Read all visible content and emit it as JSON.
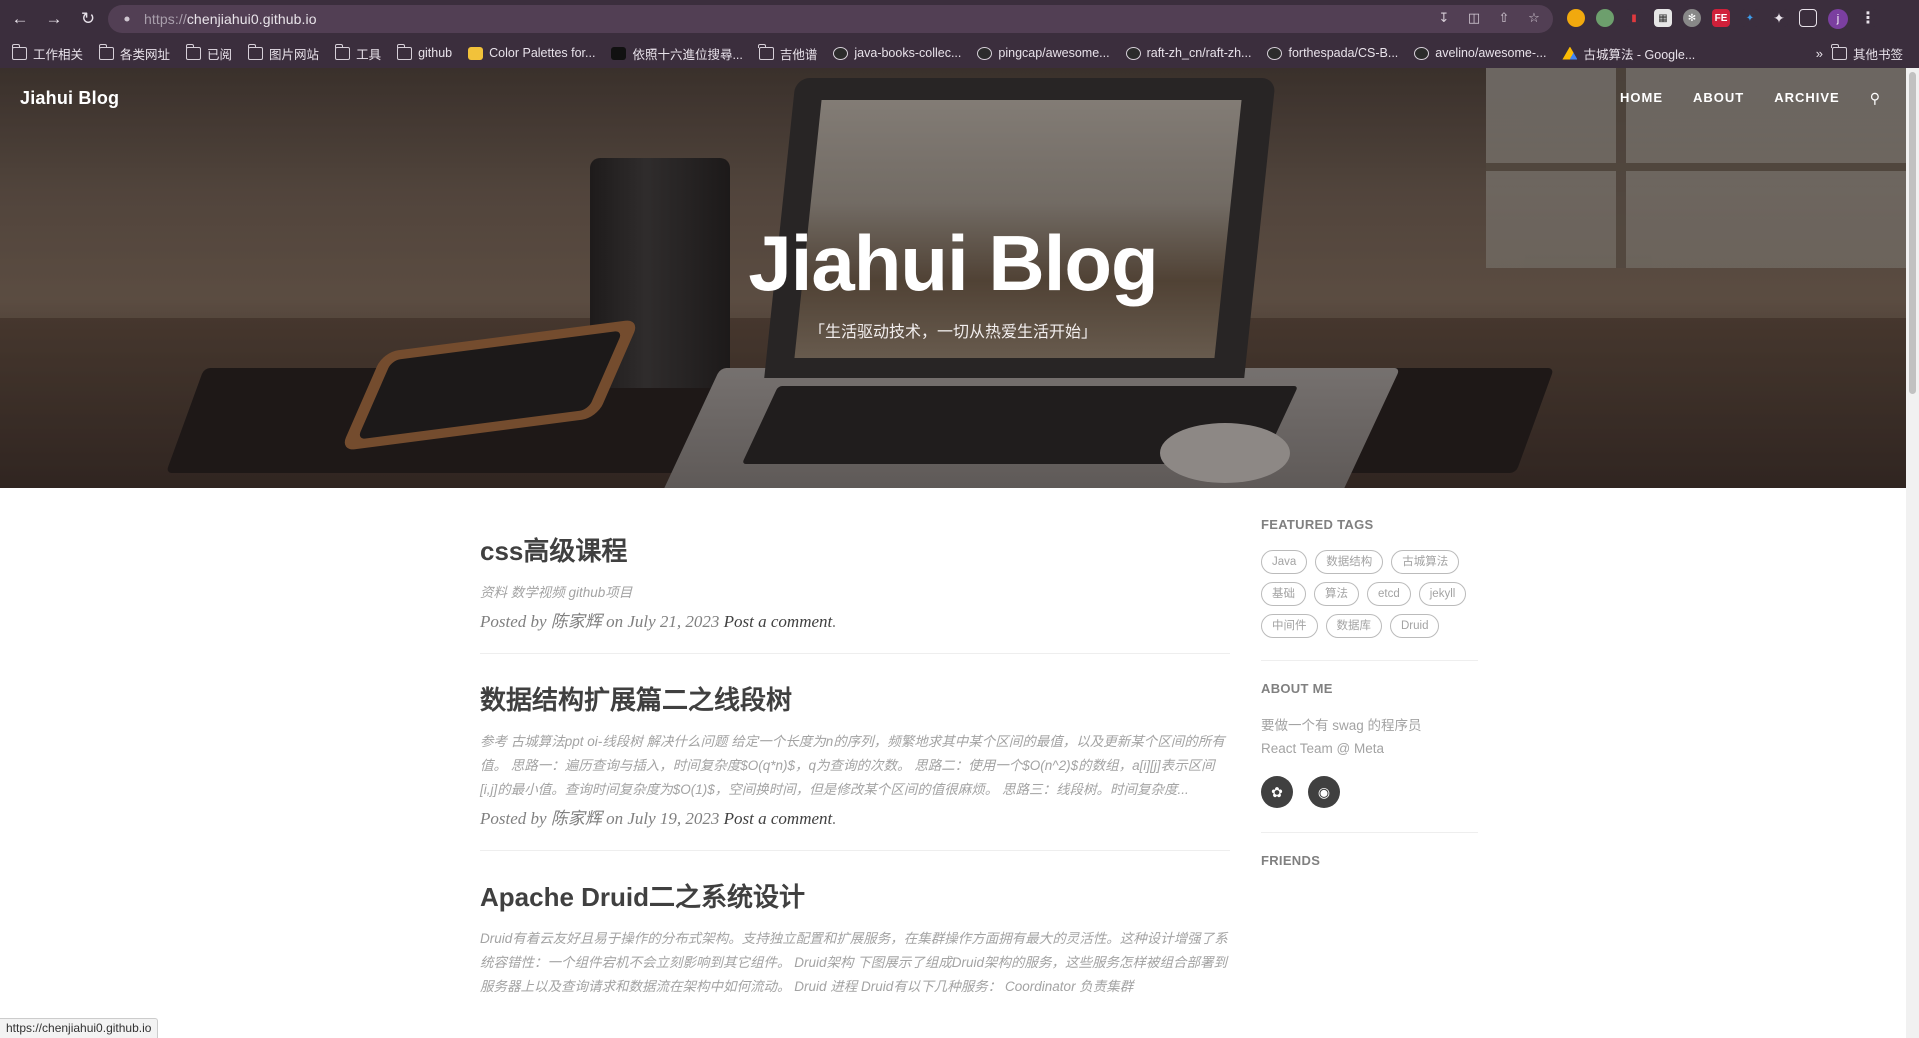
{
  "browser": {
    "url_protocol": "https://",
    "url_host": "chenjiahui0.github.io",
    "bookmarks": [
      {
        "label": "工作相关",
        "type": "folder"
      },
      {
        "label": "各类网址",
        "type": "folder"
      },
      {
        "label": "已阅",
        "type": "folder"
      },
      {
        "label": "图片网站",
        "type": "folder"
      },
      {
        "label": "工具",
        "type": "folder"
      },
      {
        "label": "github",
        "type": "folder"
      },
      {
        "label": "Color Palettes for...",
        "type": "link"
      },
      {
        "label": "依照十六進位搜尋...",
        "type": "link"
      },
      {
        "label": "吉他谱",
        "type": "folder"
      },
      {
        "label": "java-books-collec...",
        "type": "github"
      },
      {
        "label": "pingcap/awesome...",
        "type": "github"
      },
      {
        "label": "raft-zh_cn/raft-zh...",
        "type": "github"
      },
      {
        "label": "forthespada/CS-B...",
        "type": "github"
      },
      {
        "label": "avelino/awesome-...",
        "type": "github"
      },
      {
        "label": "古城算法 - Google...",
        "type": "drive"
      }
    ],
    "bookmarks_more": "»",
    "other_bookmarks": "其他书签",
    "profile_initial": "j",
    "status_url": "https://chenjiahui0.github.io"
  },
  "site": {
    "brand": "Jiahui Blog",
    "nav": [
      "HOME",
      "ABOUT",
      "ARCHIVE"
    ],
    "hero_title": "Jiahui Blog",
    "hero_subtitle": "「生活驱动技术，一切从热爱生活开始」"
  },
  "posts": [
    {
      "title": "css高级课程",
      "excerpt": "资料 数学视频 github项目",
      "posted_by": "Posted by",
      "author": "陈家辉",
      "on": "on",
      "date": "July 21, 2023",
      "comment": "Post a comment"
    },
    {
      "title": "数据结构扩展篇二之线段树",
      "excerpt": "参考 古城算法ppt oi-线段树 解决什么问题 给定一个长度为n的序列，频繁地求其中某个区间的最值，以及更新某个区间的所有值。 思路一：遍历查询与插入，时间复杂度$O(q*n)$，q为查询的次数。 思路二：使用一个$O(n^2)$的数组，a[i][j]表示区间[i,j]的最小值。查询时间复杂度为$O(1)$，空间换时间，但是修改某个区间的值很麻烦。 思路三：线段树。时间复杂度...",
      "posted_by": "Posted by",
      "author": "陈家辉",
      "on": "on",
      "date": "July 19, 2023",
      "comment": "Post a comment"
    },
    {
      "title": "Apache Druid二之系统设计",
      "excerpt": "Druid有着云友好且易于操作的分布式架构。支持独立配置和扩展服务，在集群操作方面拥有最大的灵活性。这种设计增强了系统容错性：一个组件宕机不会立刻影响到其它组件。 Druid架构 下图展示了组成Druid架构的服务，这些服务怎样被组合部署到服务器上以及查询请求和数据流在架构中如何流动。 Druid 进程 Druid有以下几种服务： Coordinator 负责集群",
      "posted_by": "",
      "author": "",
      "on": "",
      "date": "",
      "comment": ""
    }
  ],
  "sidebar": {
    "featured_tags_heading": "FEATURED TAGS",
    "tags": [
      "Java",
      "数据结构",
      "古城算法",
      "基础",
      "算法",
      "etcd",
      "jekyll",
      "中间件",
      "数据库",
      "Druid"
    ],
    "about_heading": "ABOUT ME",
    "about_line1": "要做一个有 swag 的程序员",
    "about_line2": "React Team @ Meta",
    "friends_heading": "FRIENDS"
  }
}
